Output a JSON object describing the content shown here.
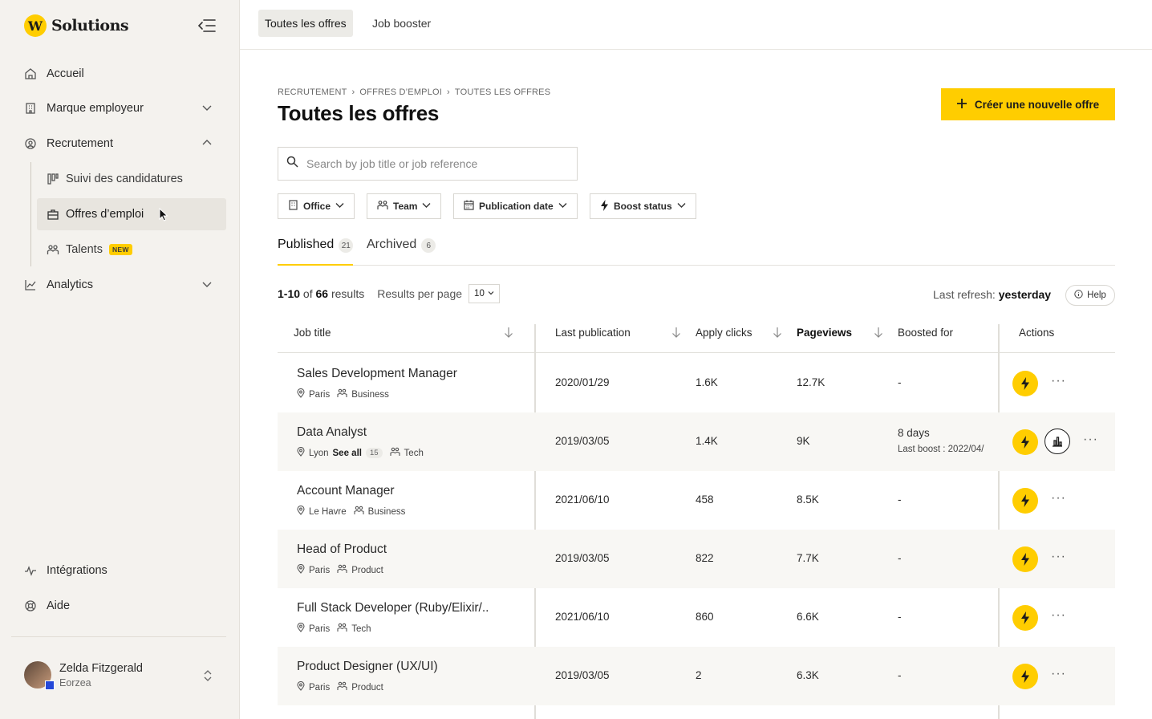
{
  "app": {
    "brand": "Solutions",
    "brand_initial": "W"
  },
  "sidebar": {
    "items": [
      {
        "label": "Accueil",
        "icon": "home-icon"
      },
      {
        "label": "Marque employeur",
        "icon": "building-icon"
      },
      {
        "label": "Recrutement",
        "icon": "recruitment-icon"
      },
      {
        "label": "Analytics",
        "icon": "chart-icon"
      }
    ],
    "sub_items": [
      {
        "label": "Suivi des candidatures",
        "icon": "kanban-icon"
      },
      {
        "label": "Offres d’emploi",
        "icon": "briefcase-icon"
      },
      {
        "label": "Talents",
        "icon": "people-icon",
        "badge": "NEW"
      }
    ],
    "bottom_items": [
      {
        "label": "Intégrations",
        "icon": "pulse-icon"
      },
      {
        "label": "Aide",
        "icon": "lifebuoy-icon"
      }
    ],
    "user": {
      "name": "Zelda Fitzgerald",
      "org": "Eorzea"
    }
  },
  "topbar": {
    "tabs": [
      "Toutes les offres",
      "Job booster"
    ]
  },
  "breadcrumb": [
    "RECRUTEMENT",
    "OFFRES D’EMPLOI",
    "TOUTES LES OFFRES"
  ],
  "page": {
    "title": "Toutes les offres",
    "create_label": "Créer une nouvelle offre",
    "search_placeholder": "Search by job title or job reference"
  },
  "filters": [
    "Office",
    "Team",
    "Publication date",
    "Boost status"
  ],
  "tabs": [
    {
      "label": "Published",
      "count": "21"
    },
    {
      "label": "Archived",
      "count": "6"
    }
  ],
  "results": {
    "range": "1-10",
    "of": "of",
    "total": "66",
    "suffix": "results",
    "per_page_label": "Results per page",
    "per_page_value": "10",
    "refresh_label": "Last refresh:",
    "refresh_value": "yesterday",
    "help_label": "Help"
  },
  "table": {
    "headers": [
      "Job title",
      "Last publication",
      "Apply clicks",
      "Pageviews",
      "Boosted for",
      "Actions"
    ],
    "rows": [
      {
        "title": "Sales Development Manager",
        "location": "Paris",
        "team": "Business",
        "last_pub": "2020/01/29",
        "clicks": "1.6K",
        "views": "12.7K",
        "boost": "-"
      },
      {
        "title": "Data Analyst",
        "location": "Lyon",
        "see_all": "See all",
        "see_all_count": "15",
        "team": "Tech",
        "last_pub": "2019/03/05",
        "clicks": "1.4K",
        "views": "9K",
        "boost": "8 days",
        "boost_sub": "Last boost : 2022/04/"
      },
      {
        "title": "Account Manager",
        "location": "Le Havre",
        "team": "Business",
        "last_pub": "2021/06/10",
        "clicks": "458",
        "views": "8.5K",
        "boost": "-"
      },
      {
        "title": "Head of Product",
        "location": "Paris",
        "team": "Product",
        "last_pub": "2019/03/05",
        "clicks": "822",
        "views": "7.7K",
        "boost": "-"
      },
      {
        "title": "Full Stack Developer (Ruby/Elixir/..",
        "location": "Paris",
        "team": "Tech",
        "last_pub": "2021/06/10",
        "clicks": "860",
        "views": "6.6K",
        "boost": "-"
      },
      {
        "title": "Product Designer (UX/UI)",
        "location": "Paris",
        "team": "Product",
        "last_pub": "2019/03/05",
        "clicks": "2",
        "views": "6.3K",
        "boost": "-"
      }
    ]
  },
  "colors": {
    "accent": "#ffcd00",
    "sidebar_bg": "#f4f2ee"
  }
}
